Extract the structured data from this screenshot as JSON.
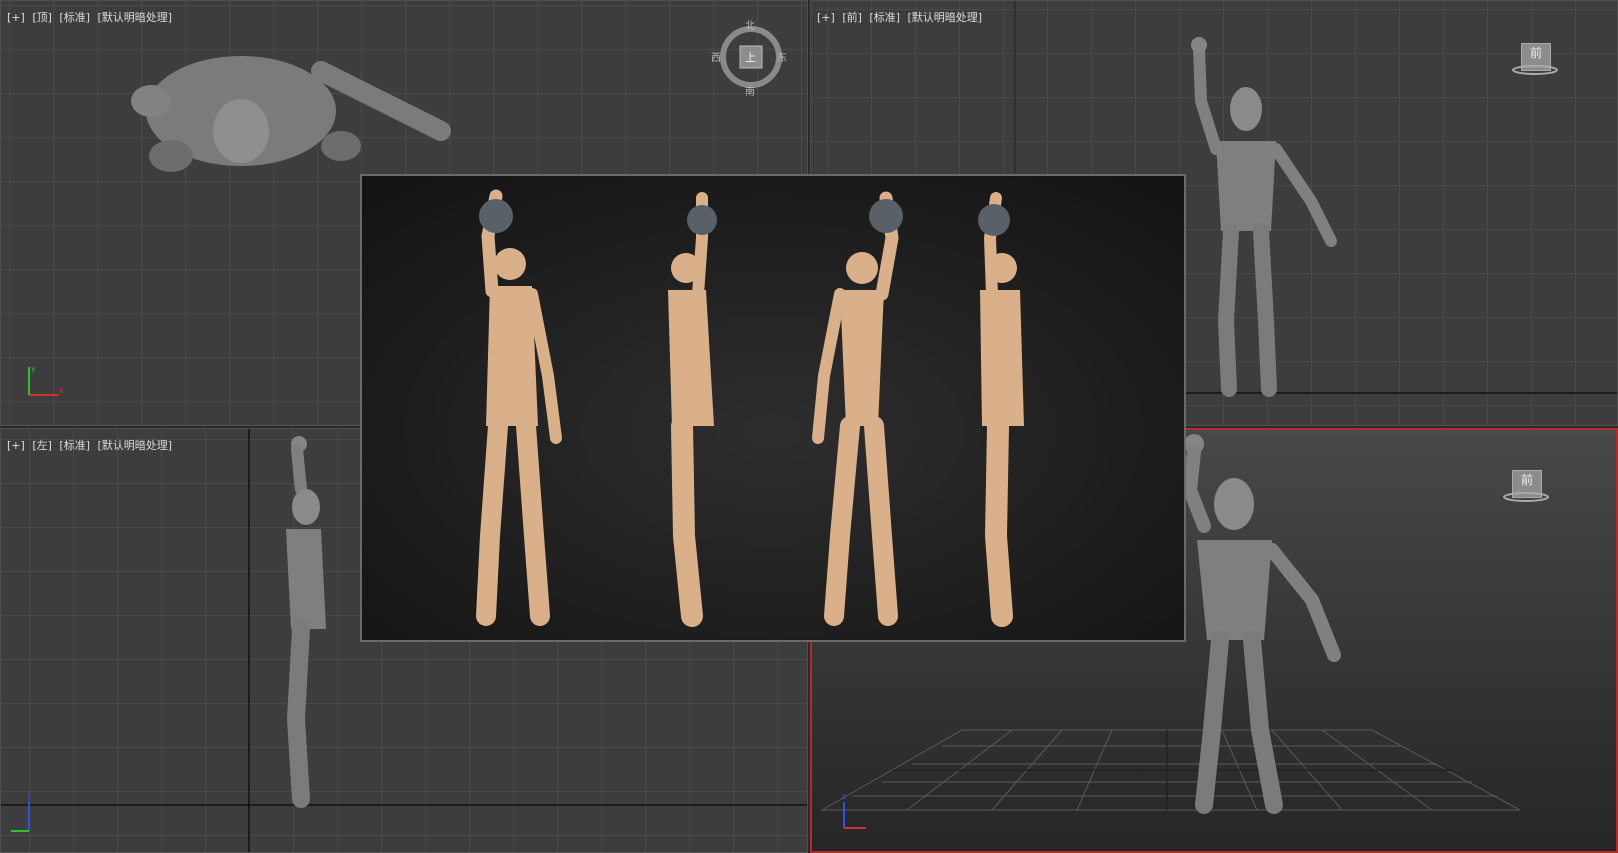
{
  "viewports": {
    "top": {
      "label": [
        "[+]",
        "[顶]",
        "[标准]",
        "[默认明暗处理]"
      ],
      "compass": {
        "n": "北",
        "s": "南",
        "e": "东",
        "w": "西",
        "face": "上"
      }
    },
    "front": {
      "label": [
        "[+]",
        "[前]",
        "[标准]",
        "[默认明暗处理]"
      ],
      "cube_face": "前"
    },
    "left": {
      "label": [
        "[+]",
        "[左]",
        "[标准]",
        "[默认明暗处理]"
      ]
    },
    "perspective": {
      "cube_face": "前"
    }
  },
  "axes": {
    "x": "x",
    "y": "y",
    "z": "z"
  },
  "colors": {
    "viewport_bg": "#3d3d3d",
    "grid": "#555555",
    "active_border": "#b32b2b",
    "axis_x": "#d03030",
    "axis_y": "#30c030",
    "axis_z": "#3050e0"
  },
  "preview": {
    "description_icon": "turnaround-render-image"
  }
}
